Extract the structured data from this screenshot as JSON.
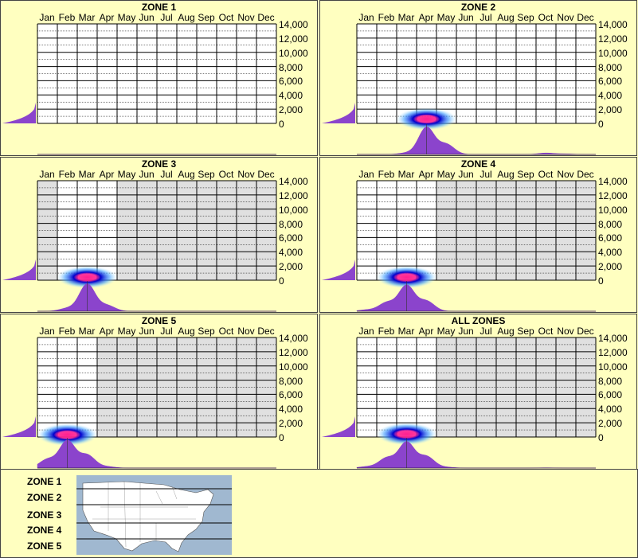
{
  "months": [
    "Jan",
    "Feb",
    "Mar",
    "Apr",
    "May",
    "Jun",
    "Jul",
    "Aug",
    "Sep",
    "Oct",
    "Nov",
    "Dec"
  ],
  "yticks": [
    "14,000",
    "12,000",
    "10,000",
    "8,000",
    "6,000",
    "4,000",
    "2,000",
    "0"
  ],
  "colors": {
    "background": "#ffffc0",
    "grid_bg": "#ffffff",
    "shade": "#e0e0e0",
    "density": "#8b44cc",
    "hot": "#ff2090",
    "cool": "#0000cc",
    "map_water": "#a0b8d0"
  },
  "legend": {
    "zones": [
      "ZONE 1",
      "ZONE 2",
      "ZONE 3",
      "ZONE 4",
      "ZONE 5"
    ]
  },
  "chart_data": [
    {
      "type": "heatmap",
      "title": "ZONE 1",
      "ylim": [
        0,
        14000
      ],
      "months_with_data": [],
      "peak_month": null,
      "elevation_density": "steep rise near 0",
      "monthly_density": []
    },
    {
      "type": "heatmap",
      "title": "ZONE 2",
      "ylim": [
        0,
        14000
      ],
      "months_with_data": [
        "Jan",
        "Feb",
        "Mar",
        "Apr",
        "May",
        "Jun",
        "Jul",
        "Aug",
        "Sep",
        "Oct",
        "Nov",
        "Dec"
      ],
      "peak_month": "Apr",
      "peak_elevation": 500,
      "elevation_density": "concentrated below 1,000",
      "monthly_density": [
        0,
        0,
        0.05,
        0.95,
        0.35,
        0,
        0,
        0,
        0,
        0.05,
        0.02,
        0
      ]
    },
    {
      "type": "heatmap",
      "title": "ZONE 3",
      "ylim": [
        0,
        14000
      ],
      "months_with_data": [
        "Feb",
        "Mar",
        "Apr"
      ],
      "peak_month": "Mar",
      "peak_elevation": 300,
      "elevation_density": "concentrated below 1,000",
      "monthly_density": [
        0,
        0.1,
        0.95,
        0.2,
        0,
        0,
        0,
        0,
        0,
        0,
        0,
        0
      ]
    },
    {
      "type": "heatmap",
      "title": "ZONE 4",
      "ylim": [
        0,
        14000
      ],
      "months_with_data": [
        "Jan",
        "Feb",
        "Mar",
        "Apr"
      ],
      "peak_month": "Mar",
      "peak_elevation": 300,
      "elevation_density": "concentrated below 1,000",
      "monthly_density": [
        0.05,
        0.3,
        0.9,
        0.35,
        0,
        0,
        0,
        0,
        0,
        0,
        0,
        0
      ]
    },
    {
      "type": "heatmap",
      "title": "ZONE 5",
      "ylim": [
        0,
        14000
      ],
      "months_with_data": [
        "Jan",
        "Feb",
        "Mar"
      ],
      "peak_month": "Feb",
      "peak_elevation": 200,
      "elevation_density": "concentrated below 1,000",
      "monthly_density": [
        0.3,
        0.95,
        0.45,
        0.05,
        0,
        0,
        0,
        0,
        0,
        0,
        0,
        0
      ]
    },
    {
      "type": "heatmap",
      "title": "ALL ZONES",
      "ylim": [
        0,
        14000
      ],
      "months_with_data": [
        "Jan",
        "Feb",
        "Mar",
        "Apr"
      ],
      "peak_month": "Mar",
      "peak_elevation": 300,
      "elevation_density": "concentrated below 1,000",
      "monthly_density": [
        0.05,
        0.35,
        0.9,
        0.4,
        0.03,
        0,
        0,
        0,
        0,
        0.01,
        0,
        0
      ]
    }
  ]
}
